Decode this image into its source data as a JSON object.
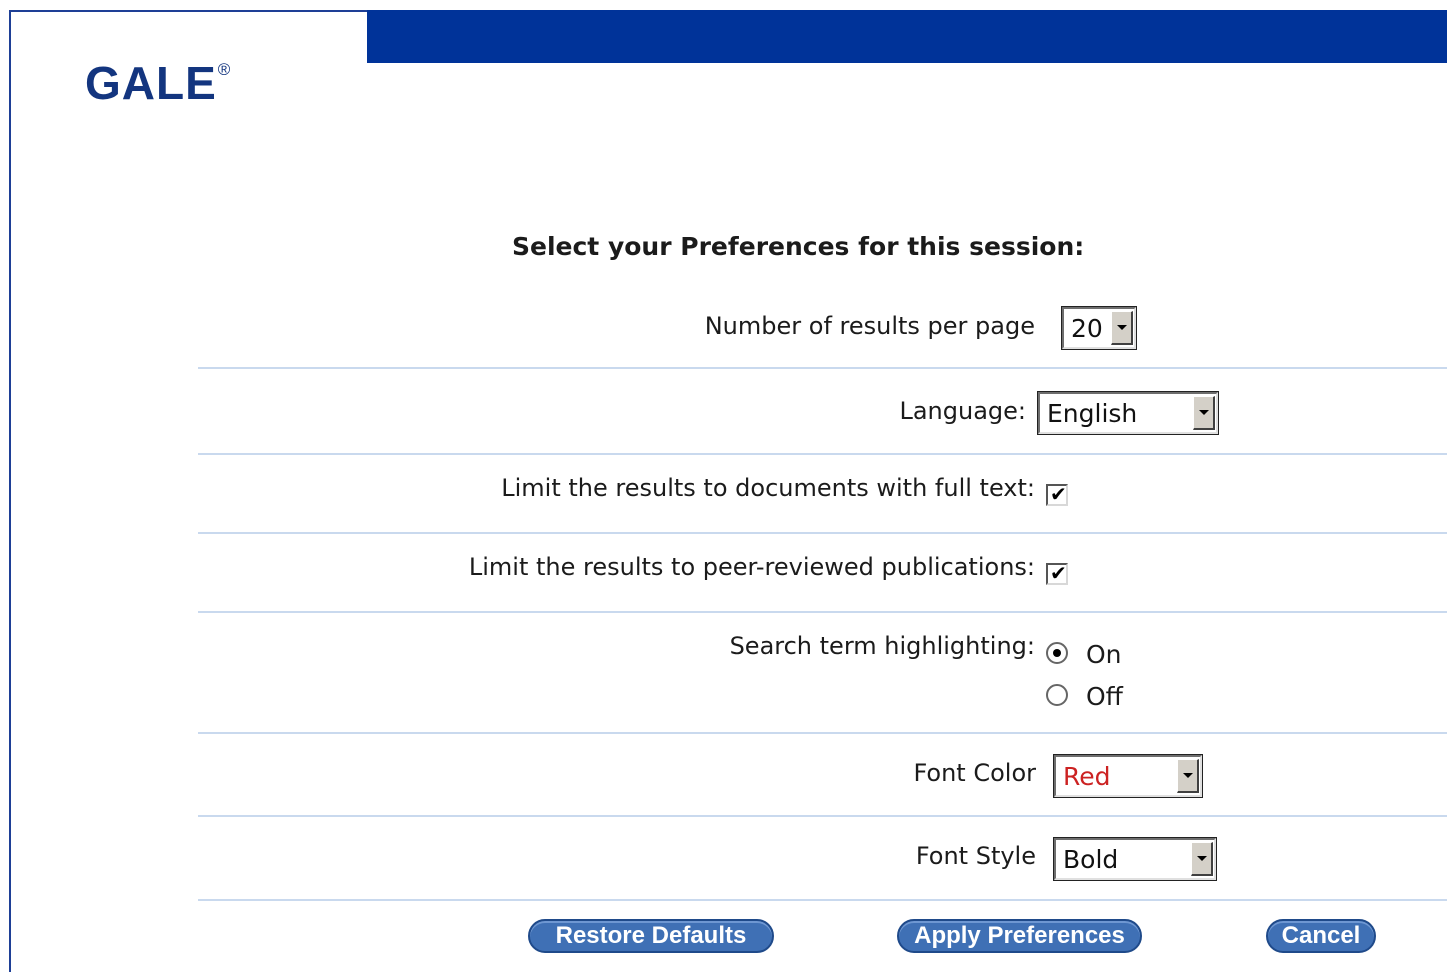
{
  "brand": {
    "logo_text": "GALE",
    "registered_mark": "®"
  },
  "colors": {
    "header_bar": "#003399",
    "logo": "#13357f",
    "separator": "#c9d9ee",
    "button": "#3f70b5",
    "font_color_value": "#cc2222"
  },
  "heading": "Select your Preferences for this session:",
  "preferences": {
    "results_per_page": {
      "label": "Number of results per page",
      "value": "20"
    },
    "language": {
      "label": "Language:",
      "value": "English"
    },
    "full_text": {
      "label": "Limit the results to documents with full text:",
      "checked": true,
      "mark": "✔"
    },
    "peer_reviewed": {
      "label": "Limit the results to peer-reviewed publications:",
      "checked": true,
      "mark": "✔"
    },
    "highlighting": {
      "label": "Search term highlighting:",
      "options": [
        "On",
        "Off"
      ],
      "selected": "On"
    },
    "font_color": {
      "label": "Font Color",
      "value": "Red"
    },
    "font_style": {
      "label": "Font Style",
      "value": "Bold"
    }
  },
  "buttons": {
    "restore": "Restore Defaults",
    "apply": "Apply Preferences",
    "cancel": "Cancel"
  }
}
